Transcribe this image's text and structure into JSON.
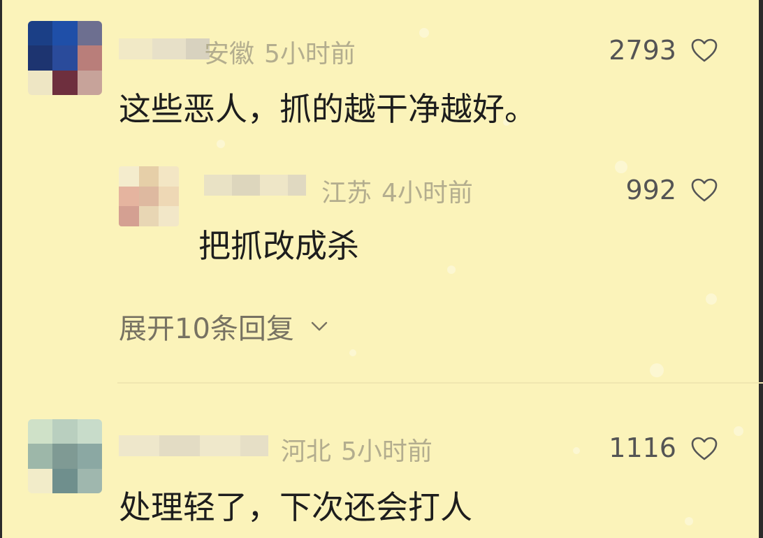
{
  "comments": [
    {
      "location": "安徽",
      "time": "5小时前",
      "likes": "2793",
      "text": "这些恶人，抓的越干净越好。"
    },
    {
      "location": "江苏",
      "time": "4小时前",
      "likes": "992",
      "text": "把抓改成杀"
    },
    {
      "location": "河北",
      "time": "5小时前",
      "likes": "1116",
      "text": "处理轻了，下次还会打人"
    }
  ],
  "expand_replies_label": "展开10条回复",
  "icons": {
    "like": "heart-outline-icon",
    "expand": "chevron-down-icon"
  },
  "colors": {
    "background": "#fbf3ba",
    "meta": "#b3ad8e",
    "likes": "#545454",
    "text": "#1d1d1d"
  }
}
